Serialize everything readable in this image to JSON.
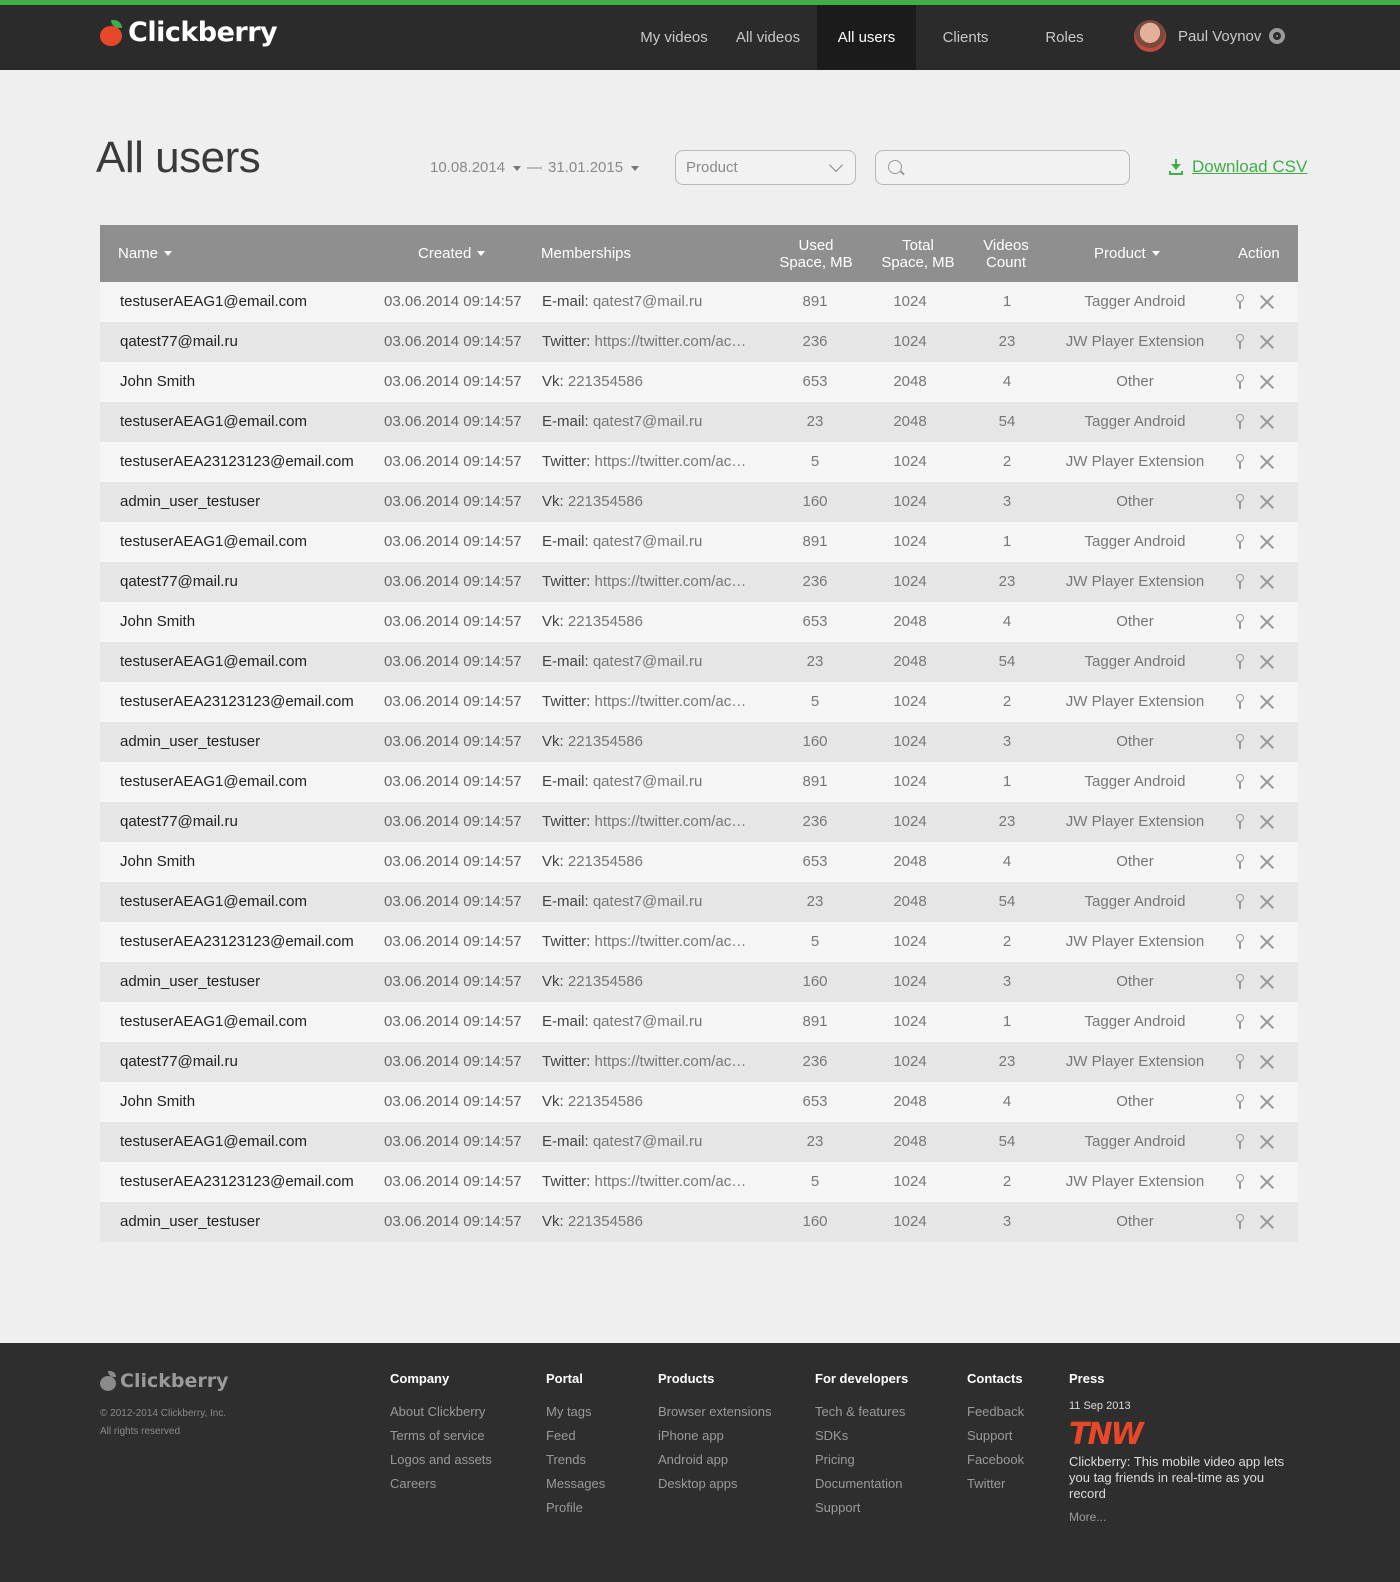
{
  "header": {
    "logo_text": "Clickberry",
    "nav": [
      "My videos",
      "All videos",
      "All users",
      "Clients",
      "Roles"
    ],
    "active_nav": "All users",
    "user_name": "Paul Voynov"
  },
  "page": {
    "title": "All users",
    "date_from": "10.08.2014",
    "date_separator": "—",
    "date_to": "31.01.2015",
    "product_select": "Product",
    "search_value": "",
    "download_label": "Download CSV"
  },
  "colors": {
    "accent": "#3fae49",
    "brand_red": "#e8472a",
    "header_bg": "#2b2b2b",
    "table_header_bg": "#8f8f8f"
  },
  "table": {
    "columns": {
      "name": "Name",
      "created": "Created",
      "memberships": "Memberships",
      "used_space_line1": "Used",
      "used_space_line2": "Space, MB",
      "total_space_line1": "Total",
      "total_space_line2": "Space, MB",
      "videos_count_line1": "Videos",
      "videos_count_line2": "Count",
      "product": "Product",
      "action": "Action"
    },
    "rows": [
      {
        "name": "testuserAEAG1@email.com",
        "created": "03.06.2014  09:14:57",
        "mem_type": "E-mail:",
        "mem_value": "qatest7@mail.ru",
        "used": "891",
        "total": "1024",
        "count": "1",
        "product": "Tagger Android"
      },
      {
        "name": "qatest77@mail.ru",
        "created": "03.06.2014  09:14:57",
        "mem_type": "Twitter:",
        "mem_value": "https://twitter.com/acc...",
        "used": "236",
        "total": "1024",
        "count": "23",
        "product": "JW Player Extension"
      },
      {
        "name": "John Smith",
        "created": "03.06.2014  09:14:57",
        "mem_type": "Vk:",
        "mem_value": "221354586",
        "used": "653",
        "total": "2048",
        "count": "4",
        "product": "Other"
      },
      {
        "name": "testuserAEAG1@email.com",
        "created": "03.06.2014  09:14:57",
        "mem_type": "E-mail:",
        "mem_value": "qatest7@mail.ru",
        "used": "23",
        "total": "2048",
        "count": "54",
        "product": "Tagger Android"
      },
      {
        "name": "testuserAEA23123123@email.com",
        "created": "03.06.2014  09:14:57",
        "mem_type": "Twitter:",
        "mem_value": "https://twitter.com/acc...",
        "used": "5",
        "total": "1024",
        "count": "2",
        "product": "JW Player Extension"
      },
      {
        "name": "admin_user_testuser",
        "created": "03.06.2014  09:14:57",
        "mem_type": "Vk:",
        "mem_value": "221354586",
        "used": "160",
        "total": "1024",
        "count": "3",
        "product": "Other"
      },
      {
        "name": "testuserAEAG1@email.com",
        "created": "03.06.2014  09:14:57",
        "mem_type": "E-mail:",
        "mem_value": "qatest7@mail.ru",
        "used": "891",
        "total": "1024",
        "count": "1",
        "product": "Tagger Android"
      },
      {
        "name": "qatest77@mail.ru",
        "created": "03.06.2014  09:14:57",
        "mem_type": "Twitter:",
        "mem_value": "https://twitter.com/acc...",
        "used": "236",
        "total": "1024",
        "count": "23",
        "product": "JW Player Extension"
      },
      {
        "name": "John Smith",
        "created": "03.06.2014  09:14:57",
        "mem_type": "Vk:",
        "mem_value": "221354586",
        "used": "653",
        "total": "2048",
        "count": "4",
        "product": "Other"
      },
      {
        "name": "testuserAEAG1@email.com",
        "created": "03.06.2014  09:14:57",
        "mem_type": "E-mail:",
        "mem_value": "qatest7@mail.ru",
        "used": "23",
        "total": "2048",
        "count": "54",
        "product": "Tagger Android"
      },
      {
        "name": "testuserAEA23123123@email.com",
        "created": "03.06.2014  09:14:57",
        "mem_type": "Twitter:",
        "mem_value": "https://twitter.com/acc...",
        "used": "5",
        "total": "1024",
        "count": "2",
        "product": "JW Player Extension"
      },
      {
        "name": "admin_user_testuser",
        "created": "03.06.2014  09:14:57",
        "mem_type": "Vk:",
        "mem_value": "221354586",
        "used": "160",
        "total": "1024",
        "count": "3",
        "product": "Other"
      },
      {
        "name": "testuserAEAG1@email.com",
        "created": "03.06.2014  09:14:57",
        "mem_type": "E-mail:",
        "mem_value": "qatest7@mail.ru",
        "used": "891",
        "total": "1024",
        "count": "1",
        "product": "Tagger Android"
      },
      {
        "name": "qatest77@mail.ru",
        "created": "03.06.2014  09:14:57",
        "mem_type": "Twitter:",
        "mem_value": "https://twitter.com/acc...",
        "used": "236",
        "total": "1024",
        "count": "23",
        "product": "JW Player Extension"
      },
      {
        "name": "John Smith",
        "created": "03.06.2014  09:14:57",
        "mem_type": "Vk:",
        "mem_value": "221354586",
        "used": "653",
        "total": "2048",
        "count": "4",
        "product": "Other"
      },
      {
        "name": "testuserAEAG1@email.com",
        "created": "03.06.2014  09:14:57",
        "mem_type": "E-mail:",
        "mem_value": "qatest7@mail.ru",
        "used": "23",
        "total": "2048",
        "count": "54",
        "product": "Tagger Android"
      },
      {
        "name": "testuserAEA23123123@email.com",
        "created": "03.06.2014  09:14:57",
        "mem_type": "Twitter:",
        "mem_value": "https://twitter.com/acc...",
        "used": "5",
        "total": "1024",
        "count": "2",
        "product": "JW Player Extension"
      },
      {
        "name": "admin_user_testuser",
        "created": "03.06.2014  09:14:57",
        "mem_type": "Vk:",
        "mem_value": "221354586",
        "used": "160",
        "total": "1024",
        "count": "3",
        "product": "Other"
      },
      {
        "name": "testuserAEAG1@email.com",
        "created": "03.06.2014  09:14:57",
        "mem_type": "E-mail:",
        "mem_value": "qatest7@mail.ru",
        "used": "891",
        "total": "1024",
        "count": "1",
        "product": "Tagger Android"
      },
      {
        "name": "qatest77@mail.ru",
        "created": "03.06.2014  09:14:57",
        "mem_type": "Twitter:",
        "mem_value": "https://twitter.com/acc...",
        "used": "236",
        "total": "1024",
        "count": "23",
        "product": "JW Player Extension"
      },
      {
        "name": "John Smith",
        "created": "03.06.2014  09:14:57",
        "mem_type": "Vk:",
        "mem_value": "221354586",
        "used": "653",
        "total": "2048",
        "count": "4",
        "product": "Other"
      },
      {
        "name": "testuserAEAG1@email.com",
        "created": "03.06.2014  09:14:57",
        "mem_type": "E-mail:",
        "mem_value": "qatest7@mail.ru",
        "used": "23",
        "total": "2048",
        "count": "54",
        "product": "Tagger Android"
      },
      {
        "name": "testuserAEA23123123@email.com",
        "created": "03.06.2014  09:14:57",
        "mem_type": "Twitter:",
        "mem_value": "https://twitter.com/acc...",
        "used": "5",
        "total": "1024",
        "count": "2",
        "product": "JW Player Extension"
      },
      {
        "name": "admin_user_testuser",
        "created": "03.06.2014  09:14:57",
        "mem_type": "Vk:",
        "mem_value": "221354586",
        "used": "160",
        "total": "1024",
        "count": "3",
        "product": "Other"
      }
    ]
  },
  "footer": {
    "logo_text": "Clickberry",
    "copyright": "© 2012-2014 Clickberry, Inc.",
    "rights": "All rights reserved",
    "columns": [
      {
        "heading": "Company",
        "links": [
          "About Clickberry",
          "Terms of service",
          "Logos and assets",
          "Careers"
        ]
      },
      {
        "heading": "Portal",
        "links": [
          "My tags",
          "Feed",
          "Trends",
          "Messages",
          "Profile"
        ]
      },
      {
        "heading": "Products",
        "links": [
          "Browser extensions",
          "iPhone app",
          "Android app",
          "Desktop apps"
        ]
      },
      {
        "heading": "For developers",
        "links": [
          "Tech & features",
          "SDKs",
          "Pricing",
          "Documentation",
          "Support"
        ]
      },
      {
        "heading": "Contacts",
        "links": [
          "Feedback",
          "Support",
          "Facebook",
          "Twitter"
        ]
      }
    ],
    "press": {
      "heading": "Press",
      "date": "11 Sep 2013",
      "source_logo": "TNW",
      "text": "Clickberry: This mobile video app lets you tag friends in real-time as you record",
      "more": "More..."
    }
  }
}
